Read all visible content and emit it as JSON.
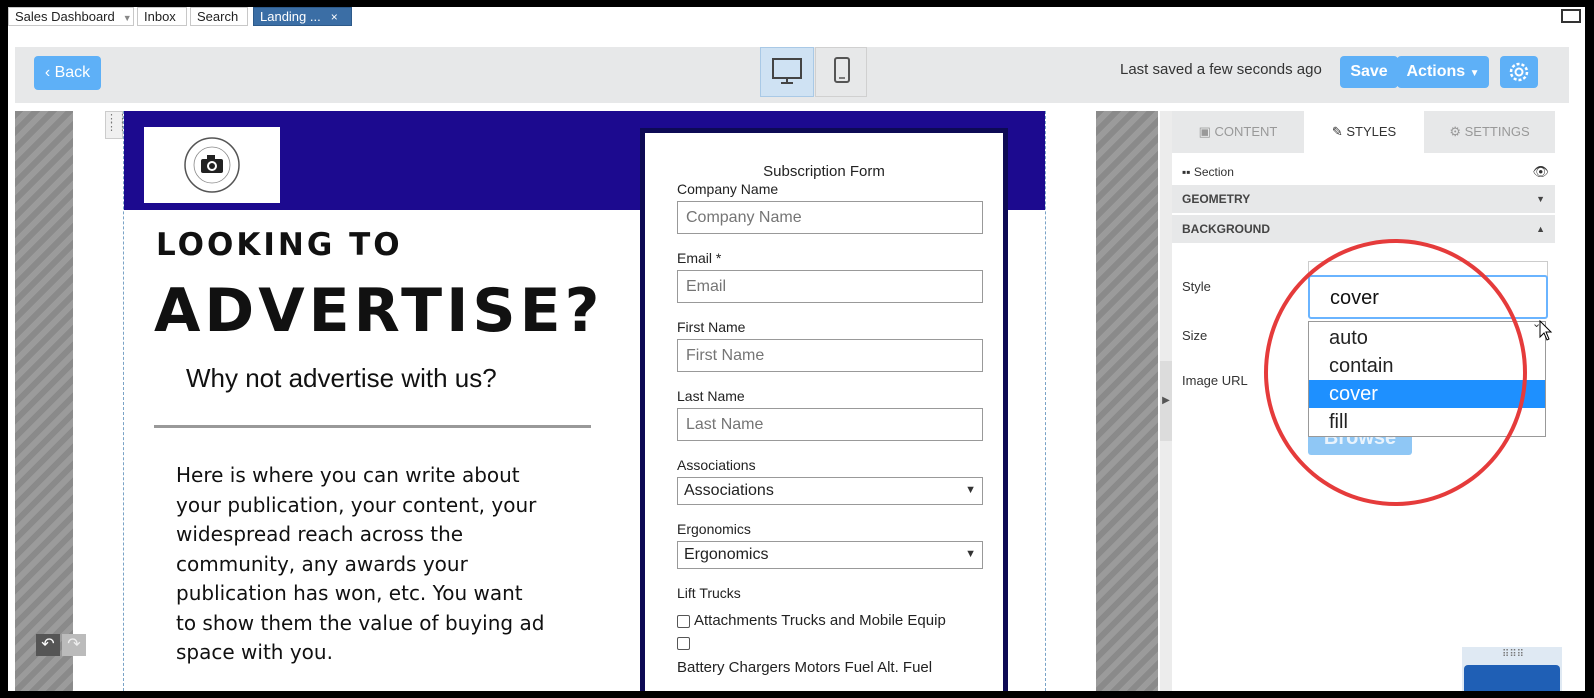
{
  "tabs": [
    {
      "label": "Sales Dashboard",
      "has_caret": true
    },
    {
      "label": "Inbox"
    },
    {
      "label": "Search"
    },
    {
      "label": "Landing ...",
      "active": true,
      "close": "×"
    }
  ],
  "toolbar": {
    "back_label": "Back",
    "last_saved": "Last saved a few seconds ago",
    "save_label": "Save",
    "actions_label": "Actions"
  },
  "page": {
    "headline_line1": "LOOKING TO",
    "headline_line2": "ADVERTISE?",
    "subheadline": "Why not advertise with us?",
    "body": "Here is where you can write about your publication, your content, your widespread reach across the community, any awards your publication has won, etc. You want to show them the value of buying ad space with you."
  },
  "form": {
    "title": "Subscription Form",
    "company_label": "Company Name",
    "company_placeholder": "Company Name",
    "email_label": "Email *",
    "email_placeholder": "Email",
    "first_label": "First Name",
    "first_placeholder": "First Name",
    "last_label": "Last Name",
    "last_placeholder": "Last Name",
    "associations_label": "Associations",
    "associations_value": "Associations",
    "ergonomics_label": "Ergonomics",
    "ergonomics_value": "Ergonomics",
    "lift_trucks_label": "Lift Trucks",
    "checkbox1_label": "Attachments Trucks and Mobile Equip",
    "checkbox2_label": "Battery Chargers Motors Fuel Alt. Fuel"
  },
  "panel": {
    "tabs": [
      "CONTENT",
      "STYLES",
      "SETTINGS"
    ],
    "active_tab": "STYLES",
    "section_label": "Section",
    "geometry_label": "GEOMETRY",
    "background_label": "BACKGROUND",
    "style_label": "Style",
    "size_label": "Size",
    "image_url_label": "Image URL",
    "browse_label": "Browse"
  },
  "size_dropdown": {
    "selected": "cover",
    "options": [
      "auto",
      "contain",
      "cover",
      "fill"
    ]
  },
  "colors": {
    "accent": "#5eb0f7",
    "header_band": "#1c0a8f",
    "form_border": "#0d0a55",
    "highlight_circle": "#e53b3b",
    "option_selected": "#1e90ff"
  }
}
